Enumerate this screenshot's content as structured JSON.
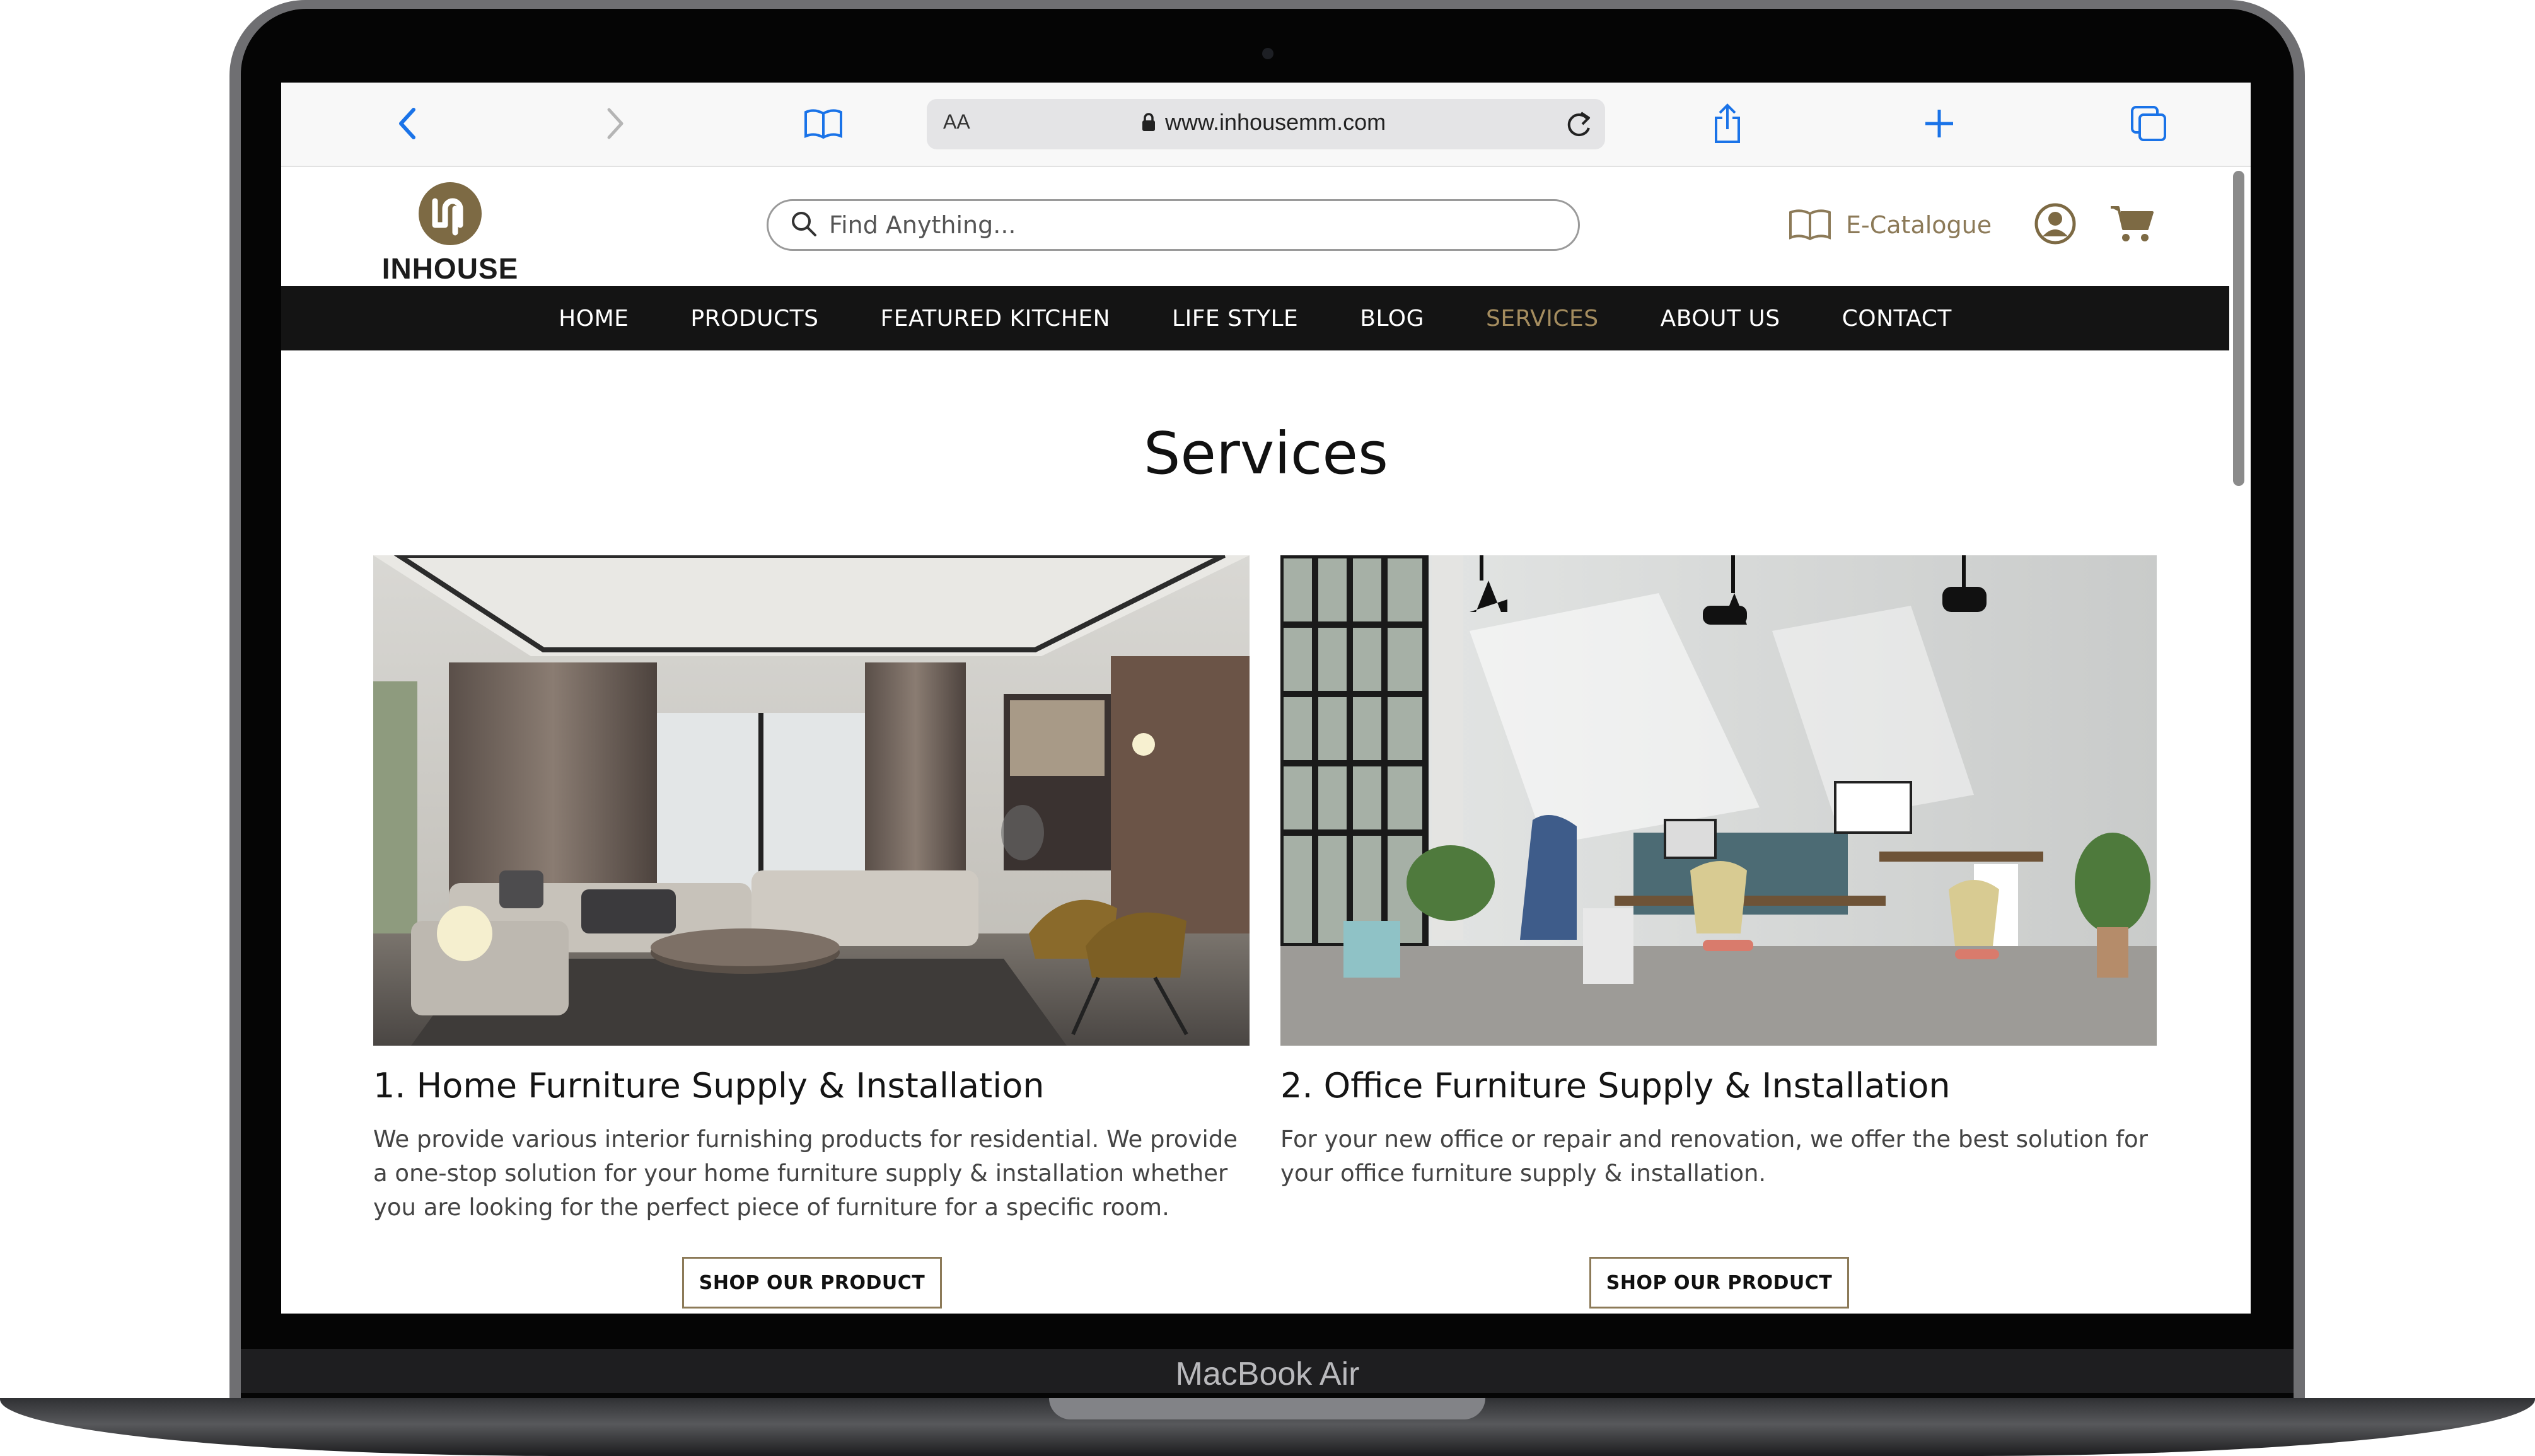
{
  "device": {
    "label": "MacBook Air"
  },
  "browser": {
    "text_size_label": "AA",
    "url": "www.inhousemm.com",
    "buttons": [
      "back-icon",
      "forward-icon",
      "bookmarks-icon",
      "reload-icon",
      "share-icon",
      "new-tab-icon",
      "tabs-icon"
    ]
  },
  "header": {
    "logo_text": "INHOUSE",
    "search_placeholder": "Find Anything...",
    "ecatalogue_label": "E-Catalogue"
  },
  "nav": {
    "items": [
      "HOME",
      "PRODUCTS",
      "FEATURED KITCHEN",
      "LIFE STYLE",
      "BLOG",
      "SERVICES",
      "ABOUT US",
      "CONTACT"
    ],
    "active": "SERVICES"
  },
  "main": {
    "title": "Services",
    "cards": [
      {
        "title": "1. Home Furniture Supply & Installation",
        "body": "We provide various interior furnishing products for residential. We provide a one-stop solution for your home furniture supply & installation whether you are looking for the perfect piece of furniture for a specific room.",
        "button": "SHOP OUR PRODUCT"
      },
      {
        "title": "2. Office Furniture Supply & Installation",
        "body": "For your new office or repair and renovation, we offer the best solution for your office furniture supply & installation.",
        "button": "SHOP OUR PRODUCT"
      }
    ]
  },
  "colors": {
    "accent": "#8c7a58",
    "nav_bg": "#141414",
    "nav_active": "#a58d5f",
    "browser_blue": "#1a73e8"
  }
}
